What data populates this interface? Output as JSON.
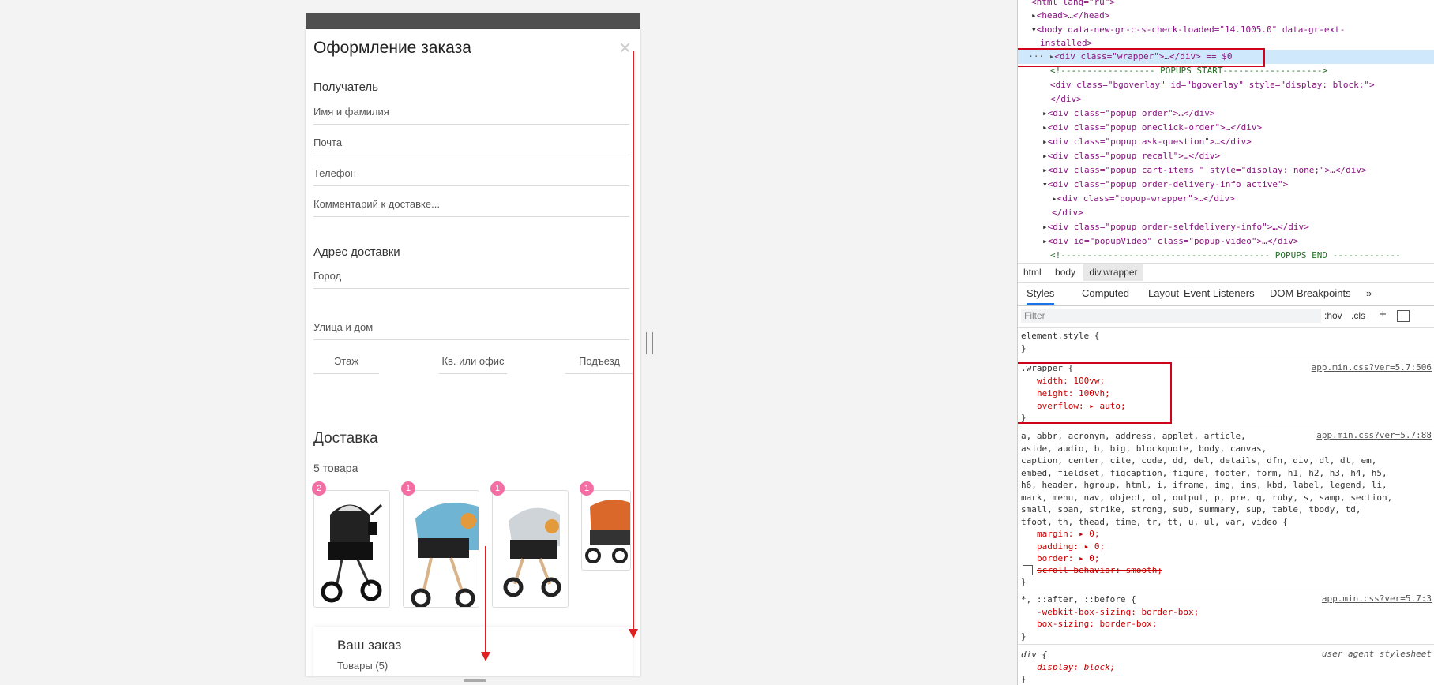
{
  "modal": {
    "title": "Оформление заказа",
    "close": "×",
    "recipient_title": "Получатель",
    "fields": {
      "name": "Имя и фамилия",
      "email": "Почта",
      "phone": "Телефон",
      "comment": "Комментарий к доставке..."
    },
    "address_title": "Адрес доставки",
    "address_fields": {
      "city": "Город",
      "street": "Улица и дом",
      "floor": "Этаж",
      "apartment": "Кв. или офис",
      "entrance": "Подъезд"
    },
    "delivery_title": "Доставка",
    "items_count": "5 товара",
    "products": [
      {
        "badge": "2"
      },
      {
        "badge": "1"
      },
      {
        "badge": "1"
      },
      {
        "badge": "1"
      }
    ],
    "order": {
      "title": "Ваш заказ",
      "subtitle": "Товары (5)"
    }
  },
  "devtools": {
    "dom": {
      "l0": "<html lang=\"ru\">",
      "l1": "<head>…</head>",
      "l2a": "<body data-new-gr-c-s-check-loaded=\"14.1005.0\" data-gr-ext-",
      "l2b": "installed>",
      "l3": "<div class=\"wrapper\">…</div> == $0",
      "l4": "<!------------------ POPUPS START------------------->",
      "l5": "<div class=\"bgoverlay\" id=\"bgoverlay\" style=\"display: block;\">",
      "l6": "</div>",
      "l7": "<div class=\"popup order\">…</div>",
      "l8": "<div class=\"popup oneclick-order\">…</div>",
      "l9": "<div class=\"popup ask-question\">…</div>",
      "l10": "<div class=\"popup recall\">…</div>",
      "l11": "<div class=\"popup cart-items \" style=\"display: none;\">…</div>",
      "l12": "<div class=\"popup order-delivery-info active\">",
      "l13": "<div class=\"popup-wrapper\">…</div>",
      "l14": "</div>",
      "l15": "<div class=\"popup order-selfdelivery-info\">…</div>",
      "l16": "<div id=\"popupVideo\" class=\"popup-video\">…</div>",
      "l17": "<!---------------------------------------- POPUPS END -------------"
    },
    "breadcrumbs": [
      "html",
      "body",
      "div.wrapper"
    ],
    "tabs": [
      "Styles",
      "Computed",
      "Layout",
      "Event Listeners",
      "DOM Breakpoints",
      "»"
    ],
    "filter_placeholder": "Filter",
    "hov": ":hov",
    "cls": ".cls",
    "plus": "+",
    "element_style": "element.style {",
    "close_brace": "}",
    "wrapper_rule": {
      "selector": ".wrapper {",
      "source": "app.min.css?ver=5.7:506",
      "width": "width: 100vw;",
      "height": "height: 100vh;",
      "overflow": "overflow: ▸ auto;"
    },
    "reset_rule": {
      "source": "app.min.css?ver=5.7:88",
      "s1": "a, abbr, acronym, address, applet, article,",
      "s2": "aside, audio, b, big, blockquote, body, canvas,",
      "s3": "caption, center, cite, code, dd, del, details, dfn, div, dl, dt, em,",
      "s4": "embed, fieldset, figcaption, figure, footer, form, h1, h2, h3, h4, h5,",
      "s5": "h6, header, hgroup, html, i, iframe, img, ins, kbd, label, legend, li,",
      "s6": "mark, menu, nav, object, ol, output, p, pre, q, ruby, s, samp, section,",
      "s7": "small, span, strike, strong, sub, summary, sup, table, tbody, td,",
      "s8": "tfoot, th, thead, time, tr, tt, u, ul, var, video {",
      "margin": "margin: ▸ 0;",
      "padding": "padding: ▸ 0;",
      "border": "border: ▸ 0;",
      "scroll": "scroll-behavior: smooth;"
    },
    "star_rule": {
      "selector": "*, ::after, ::before {",
      "source": "app.min.css?ver=5.7:3",
      "p1": "-webkit-box-sizing: border-box;",
      "p2": "box-sizing: border-box;"
    },
    "div_rule": {
      "selector": "div {",
      "source": "user agent stylesheet",
      "p1": "display: block;"
    }
  },
  "colors": {
    "annotation_red": "#e02020",
    "badge_pink": "#f26ea3"
  }
}
